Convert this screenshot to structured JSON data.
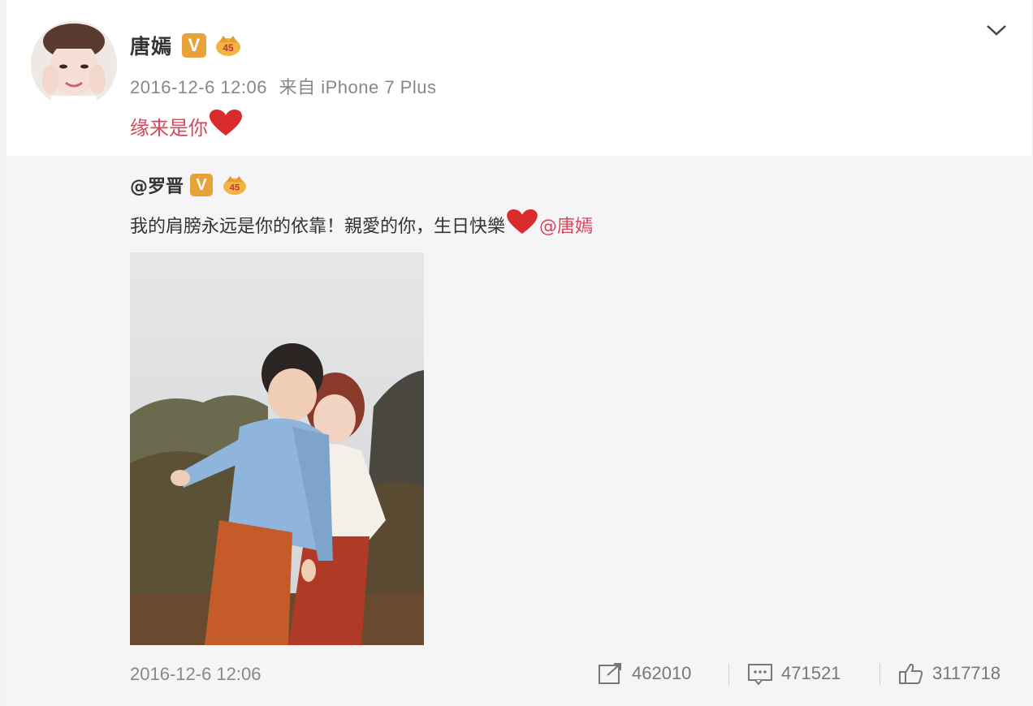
{
  "post": {
    "user_name": "唐嫣",
    "verified_badge": "V",
    "timestamp": "2016-12-6 12:06",
    "source": "来自 iPhone 7 Plus",
    "text": "缘来是你",
    "heart_icon": "heart-icon"
  },
  "repost": {
    "user": "@罗晋",
    "verified_badge": "V",
    "text": "我的肩膀永远是你的依靠！親愛的你，生日快樂",
    "mention": "@唐嫣"
  },
  "footer": {
    "timestamp": "2016-12-6 12:06",
    "reposts": "462010",
    "comments": "471521",
    "likes": "3117718"
  },
  "colors": {
    "accent": "#d9455b",
    "badge": "#e8a23a",
    "meta_text": "#888888"
  }
}
